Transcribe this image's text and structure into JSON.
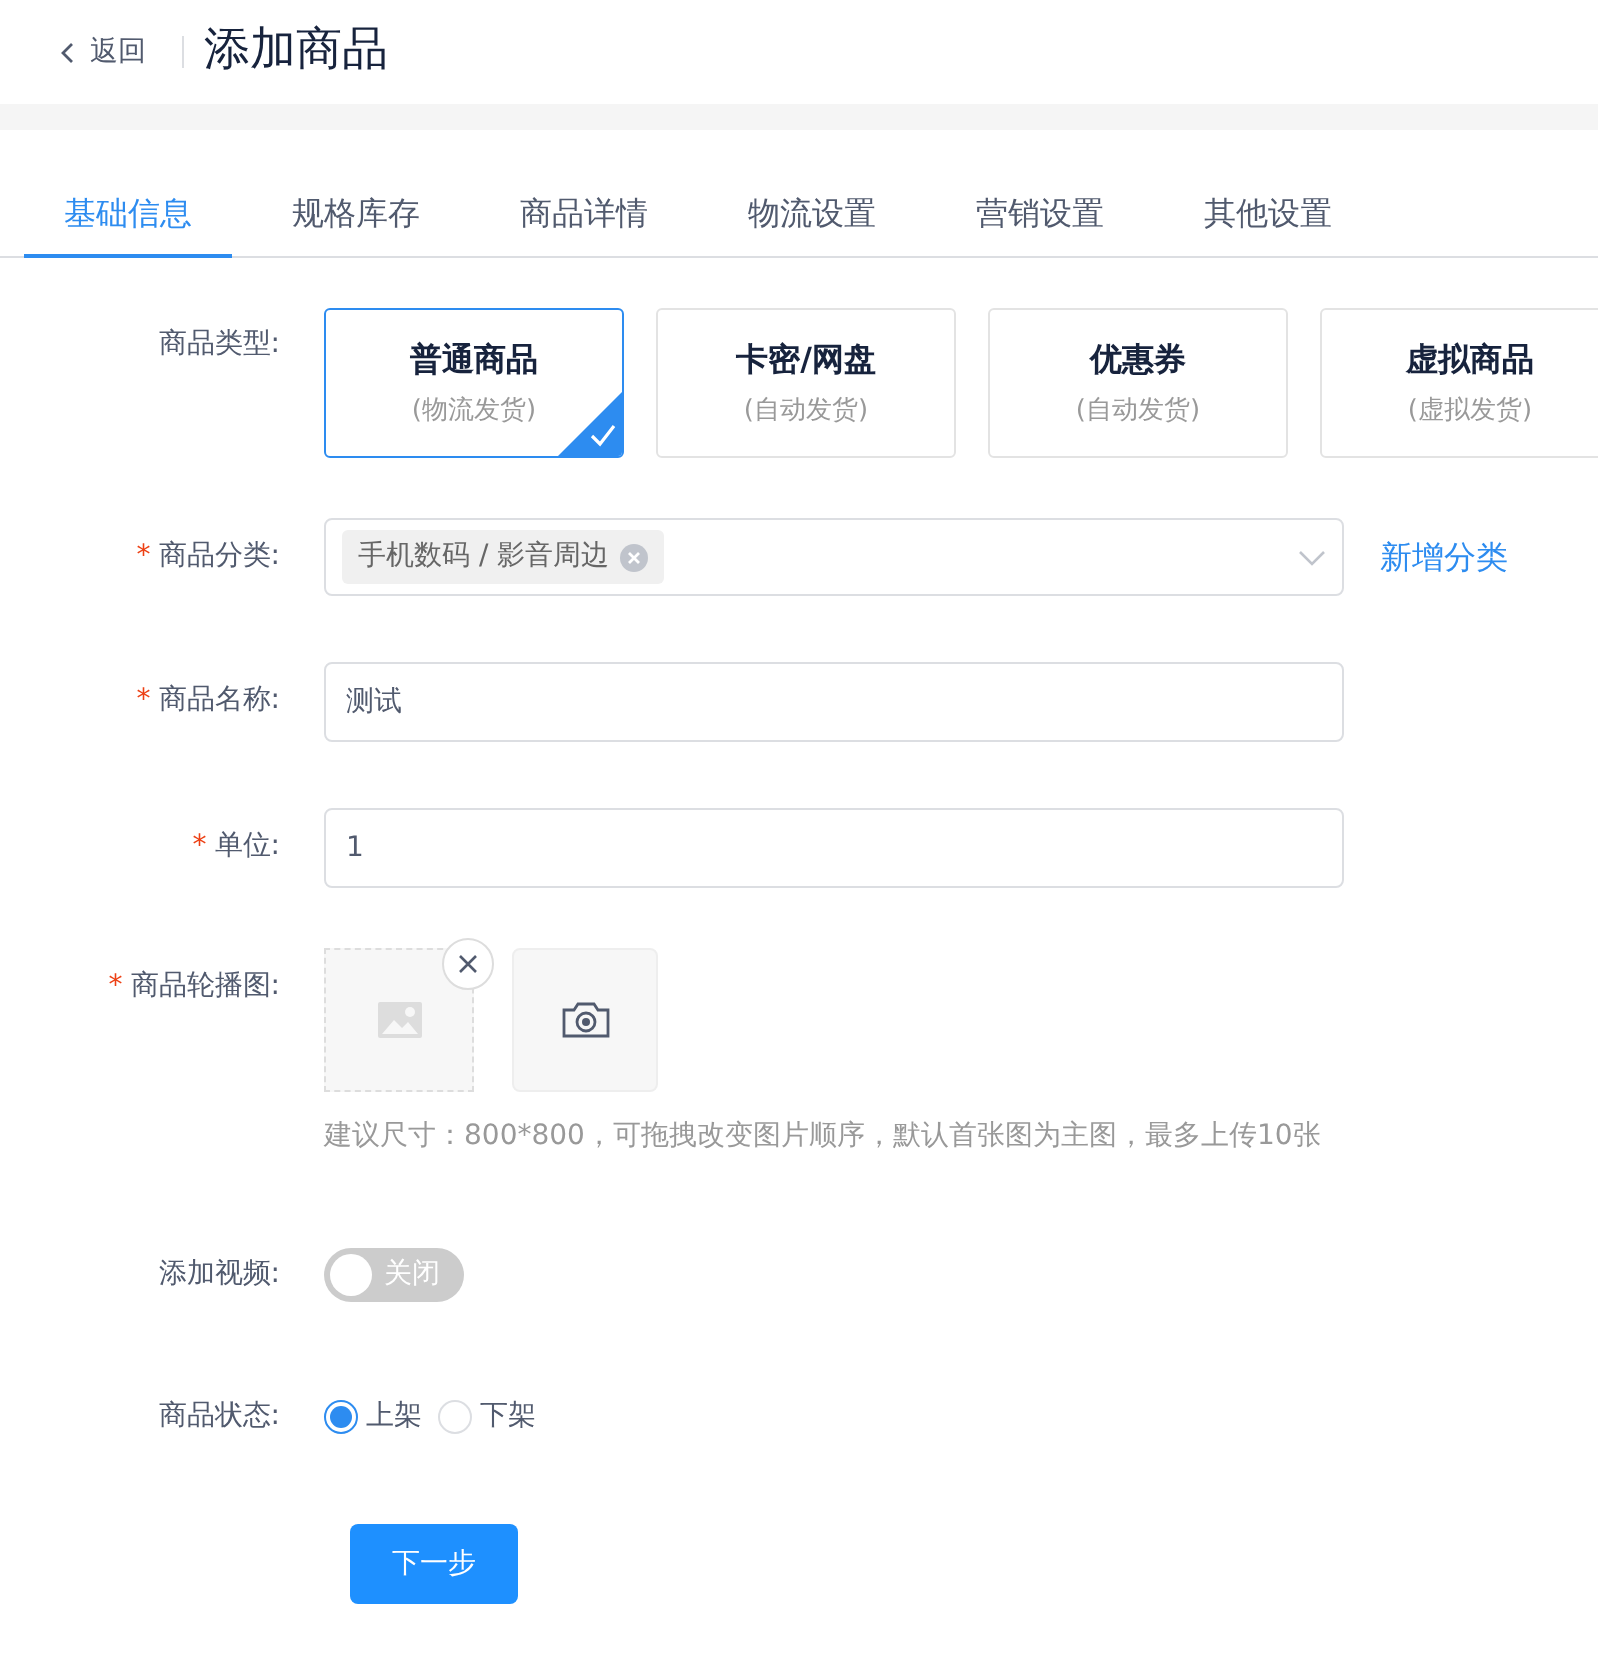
{
  "header": {
    "back": "返回",
    "title": "添加商品"
  },
  "tabs": [
    {
      "label": "基础信息",
      "selected": true
    },
    {
      "label": "规格库存",
      "selected": false
    },
    {
      "label": "商品详情",
      "selected": false
    },
    {
      "label": "物流设置",
      "selected": false
    },
    {
      "label": "营销设置",
      "selected": false
    },
    {
      "label": "其他设置",
      "selected": false
    }
  ],
  "product_type": {
    "label": "商品类型:",
    "options": [
      {
        "title": "普通商品",
        "subtitle": "(物流发货)",
        "selected": true
      },
      {
        "title": "卡密/网盘",
        "subtitle": "(自动发货)",
        "selected": false
      },
      {
        "title": "优惠券",
        "subtitle": "(自动发货)",
        "selected": false
      },
      {
        "title": "虚拟商品",
        "subtitle": "(虚拟发货)",
        "selected": false
      }
    ]
  },
  "category": {
    "label": "商品分类:",
    "required_mark": "*",
    "tags": [
      "手机数码 / 影音周边"
    ],
    "link": "新增分类"
  },
  "name": {
    "label": "商品名称:",
    "required_mark": "*",
    "value": "测试"
  },
  "unit": {
    "label": "单位:",
    "required_mark": "*",
    "value": "1"
  },
  "images": {
    "label": "商品轮播图:",
    "required_mark": "*",
    "hint": "建议尺寸：800*800，可拖拽改变图片顺序，默认首张图为主图，最多上传10张"
  },
  "video": {
    "label": "添加视频:",
    "on": false,
    "switch_text": "关闭"
  },
  "status": {
    "label": "商品状态:",
    "options": [
      {
        "label": "上架",
        "selected": true
      },
      {
        "label": "下架",
        "selected": false
      }
    ]
  },
  "next_button": "下一步"
}
